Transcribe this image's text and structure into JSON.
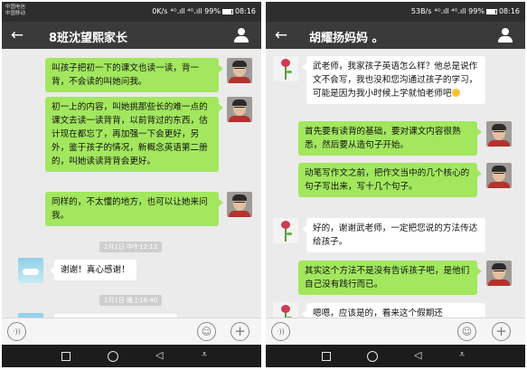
{
  "left": {
    "status": {
      "carrier_1": "中国电信",
      "carrier_2": "中国移动",
      "speed": "0K/s",
      "signal": "⁴ᴳ.ıll ⁴ᴳ.ıll 99%",
      "time": "08:16"
    },
    "title": "8班沈望熙家长",
    "messages": [
      {
        "text": "叫孩子把初一下的课文也读一读，背一背，不会读的叫她问我。"
      },
      {
        "text": "初一上的内容，叫她挑那些长的难一点的课文去读一读背背，以前背过的东西，估计现在都忘了，再加强一下会更好，另外，鉴于孩子的情况，新概念英语第二册的，叫她读读背背会更好。"
      },
      {
        "text": "同样的，不太懂的地方，也可以让她来问我。"
      },
      {
        "text": "谢谢！真心感谢！"
      }
    ],
    "timestamps": [
      "2月1日 中午12:12",
      "2月1日 晚上16:40"
    ]
  },
  "right": {
    "status": {
      "speed": "53B/s",
      "signal": "⁴ᴳ.ıll ⁴ᴳ.ıll 99%",
      "time": "08:16"
    },
    "title": "胡耀扬妈妈 。",
    "messages": [
      {
        "text": "武老师，我家孩子英语怎么样？他总是说作文不会写，我也没和您沟通过孩子的学习，可能是因为我小时候上学就怕老师吧"
      },
      {
        "text": "首先要有读背的基础，要对课文内容很熟悉，然后要从造句子开始。"
      },
      {
        "text": "动笔写作文之前，把作文当中的几个核心的句子写出来，写十几个句子。"
      },
      {
        "text": "好的，谢谢武老师，一定把您说的方法传达给孩子。"
      },
      {
        "text": "其实这个方法不是没有告诉孩子吧，是他们自己没有践行而已。"
      },
      {
        "text": "嗯嗯，应该是的，看来这个假期还"
      }
    ]
  },
  "icons": {
    "back": "←",
    "voice": "·))",
    "emoji": "☺",
    "plus": "+",
    "nav_back": "◁",
    "nav_down": "⩡"
  }
}
